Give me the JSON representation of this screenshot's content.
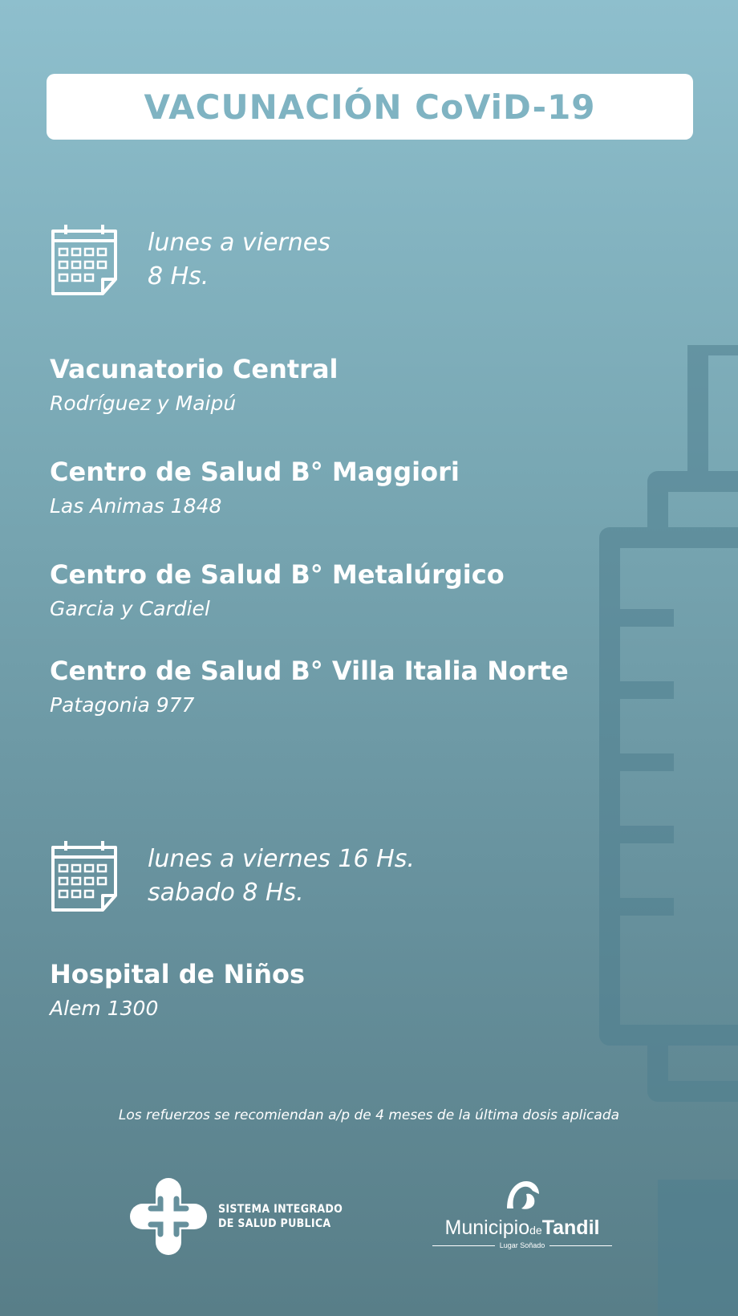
{
  "header": {
    "title": "VACUNACIÓN CoViD-19"
  },
  "schedules": [
    {
      "icon": "calendar-icon",
      "lines": [
        "lunes a viernes",
        "8 Hs."
      ]
    },
    {
      "icon": "calendar-icon",
      "lines": [
        "lunes a viernes 16 Hs.",
        "sabado 8 Hs."
      ]
    }
  ],
  "places": [
    {
      "name": "Vacunatorio Central",
      "address": "Rodríguez y Maipú"
    },
    {
      "name": "Centro de Salud B° Maggiori",
      "address": "Las Animas 1848"
    },
    {
      "name": "Centro de Salud B° Metalúrgico",
      "address": "Garcia y Cardiel"
    },
    {
      "name": "Centro de Salud B° Villa Italia Norte",
      "address": "Patagonia 977"
    },
    {
      "name": "Hospital de Niños",
      "address": "Alem 1300"
    }
  ],
  "footnote": "Los refuerzos se recomiendan a/p de 4 meses de la última dosis aplicada",
  "logos": {
    "sisp": {
      "line1": "SISTEMA INTEGRADO",
      "line2": "DE SALUD PUBLICA"
    },
    "tandil": {
      "municipio": "Municipio",
      "de": "de",
      "tandil": "Tandil",
      "tagline": "Lugar Soñado"
    }
  },
  "colors": {
    "accent": "#7fb3c2",
    "text": "#ffffff"
  }
}
